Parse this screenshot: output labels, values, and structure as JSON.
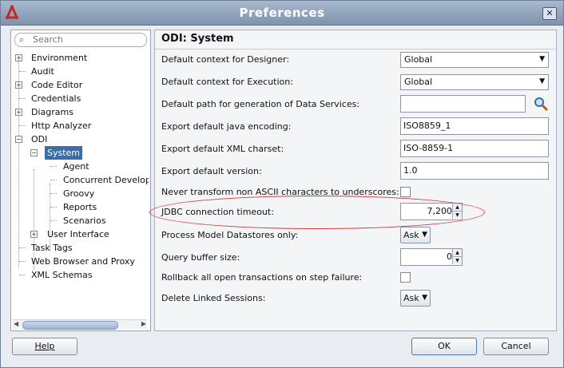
{
  "window": {
    "title": "Preferences",
    "close_label": "✕"
  },
  "search": {
    "placeholder": "Search"
  },
  "tree": {
    "environment": "Environment",
    "audit": "Audit",
    "code_editor": "Code Editor",
    "credentials": "Credentials",
    "diagrams": "Diagrams",
    "http_analyzer": "Http Analyzer",
    "odi": "ODI",
    "system": "System",
    "agent": "Agent",
    "concurrent": "Concurrent Develop",
    "groovy": "Groovy",
    "reports": "Reports",
    "scenarios": "Scenarios",
    "user_interface": "User Interface",
    "task_tags": "Task Tags",
    "web_browser": "Web Browser and Proxy",
    "xml_schemas": "XML Schemas"
  },
  "page": {
    "title": "ODI: System",
    "rows": {
      "context_designer": {
        "label": "Default context for Designer:",
        "value": "Global"
      },
      "context_execution": {
        "label": "Default context for Execution:",
        "value": "Global"
      },
      "data_services_path": {
        "label": "Default path for generation of Data Services:",
        "value": ""
      },
      "java_encoding": {
        "label": "Export default java encoding:",
        "value": "ISO8859_1"
      },
      "xml_charset": {
        "label": "Export default XML charset:",
        "value": "ISO-8859-1"
      },
      "export_version": {
        "label": "Export default version:",
        "value": "1.0"
      },
      "never_transform": {
        "label": "Never transform non ASCII characters to underscores:"
      },
      "jdbc_timeout": {
        "label": "JDBC connection timeout:",
        "value": "7,200"
      },
      "process_model": {
        "label": "Process Model Datastores only:",
        "value": "Ask"
      },
      "query_buffer": {
        "label": "Query buffer size:",
        "value": "0"
      },
      "rollback": {
        "label": "Rollback all open transactions on step failure:"
      },
      "delete_linked": {
        "label": "Delete Linked Sessions:",
        "value": "Ask"
      }
    }
  },
  "buttons": {
    "help": "Help",
    "ok": "OK",
    "cancel": "Cancel"
  },
  "colors": {
    "selection": "#3b6ea5",
    "highlight_ellipse": "#d23c3c",
    "titlebar": "#8fa3bc"
  }
}
